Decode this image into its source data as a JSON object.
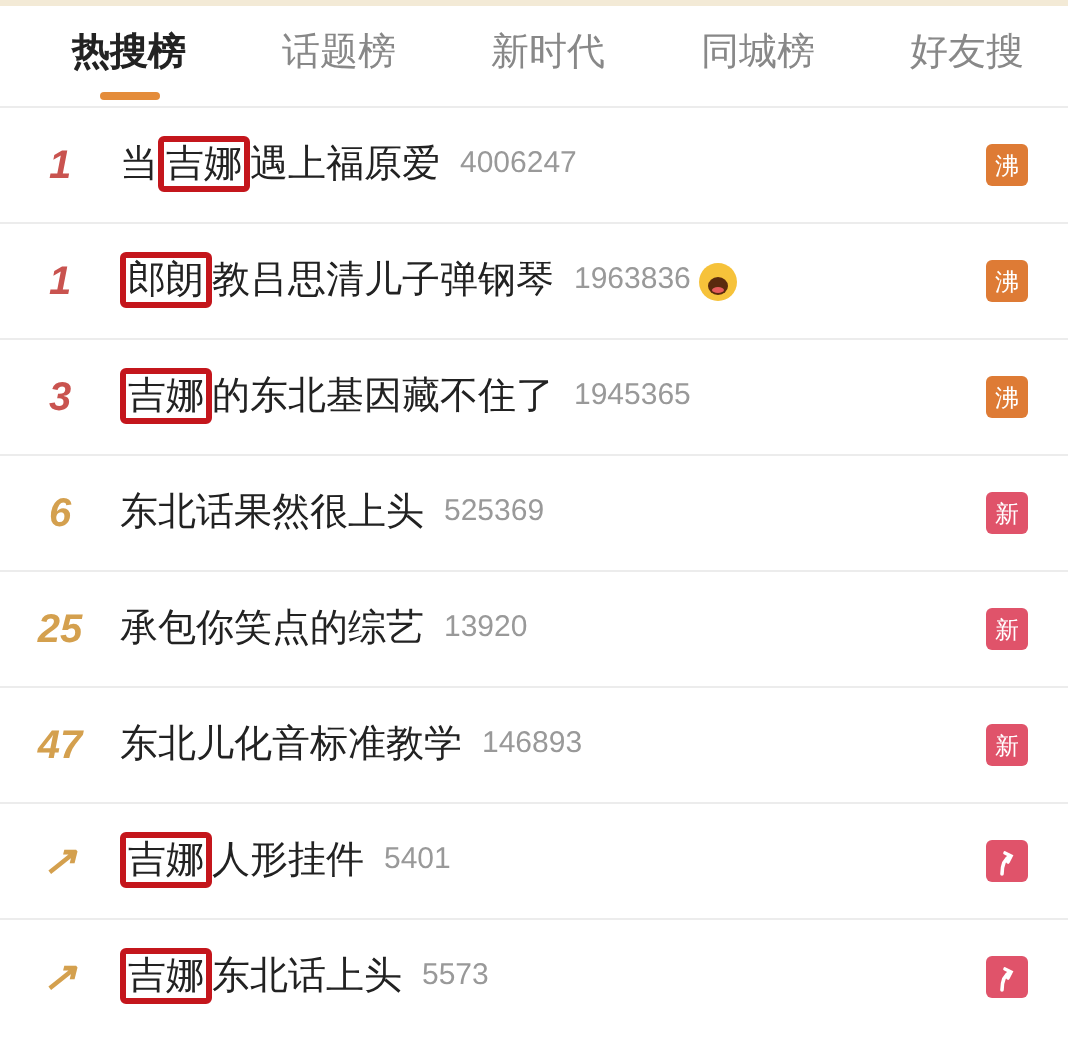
{
  "tabs": [
    {
      "label": "热搜榜",
      "selected": true
    },
    {
      "label": "话题榜",
      "selected": false
    },
    {
      "label": "新时代",
      "selected": false
    },
    {
      "label": "同城榜",
      "selected": false
    },
    {
      "label": "好友搜",
      "selected": false
    }
  ],
  "rows": [
    {
      "rank": "1",
      "color": "#c9534f",
      "parts": [
        {
          "text": "当",
          "boxed": false
        },
        {
          "text": "吉娜",
          "boxed": true
        },
        {
          "text": "遇上福原爱",
          "boxed": false
        }
      ],
      "count": "4006247",
      "emoji": false,
      "badge": {
        "kind": "boil",
        "text": "沸"
      }
    },
    {
      "rank": "1",
      "color": "#c9534f",
      "parts": [
        {
          "text": "郎朗",
          "boxed": true
        },
        {
          "text": "教吕思清儿子弹钢琴",
          "boxed": false
        }
      ],
      "count": "1963836",
      "emoji": true,
      "badge": {
        "kind": "boil",
        "text": "沸"
      }
    },
    {
      "rank": "3",
      "color": "#c9534f",
      "parts": [
        {
          "text": "吉娜",
          "boxed": true
        },
        {
          "text": "的东北基因藏不住了",
          "boxed": false
        }
      ],
      "count": "1945365",
      "emoji": false,
      "badge": {
        "kind": "boil",
        "text": "沸"
      }
    },
    {
      "rank": "6",
      "color": "#d4a04e",
      "parts": [
        {
          "text": "东北话果然很上头",
          "boxed": false
        }
      ],
      "count": "525369",
      "emoji": false,
      "badge": {
        "kind": "new",
        "text": "新"
      }
    },
    {
      "rank": "25",
      "color": "#d4a04e",
      "parts": [
        {
          "text": "承包你笑点的综艺",
          "boxed": false
        }
      ],
      "count": "13920",
      "emoji": false,
      "badge": {
        "kind": "new",
        "text": "新"
      }
    },
    {
      "rank": "47",
      "color": "#d4a04e",
      "parts": [
        {
          "text": "东北儿化音标准教学",
          "boxed": false
        }
      ],
      "count": "146893",
      "emoji": false,
      "badge": {
        "kind": "new",
        "text": "新"
      }
    },
    {
      "rank": "↗",
      "color": "#d4a04e",
      "parts": [
        {
          "text": "吉娜",
          "boxed": true
        },
        {
          "text": "人形挂件",
          "boxed": false
        }
      ],
      "count": "5401",
      "emoji": false,
      "badge": {
        "kind": "rise"
      }
    },
    {
      "rank": "↗",
      "color": "#d4a04e",
      "parts": [
        {
          "text": "吉娜",
          "boxed": true
        },
        {
          "text": "东北话上头",
          "boxed": false
        }
      ],
      "count": "5573",
      "emoji": false,
      "badge": {
        "kind": "rise"
      }
    }
  ]
}
